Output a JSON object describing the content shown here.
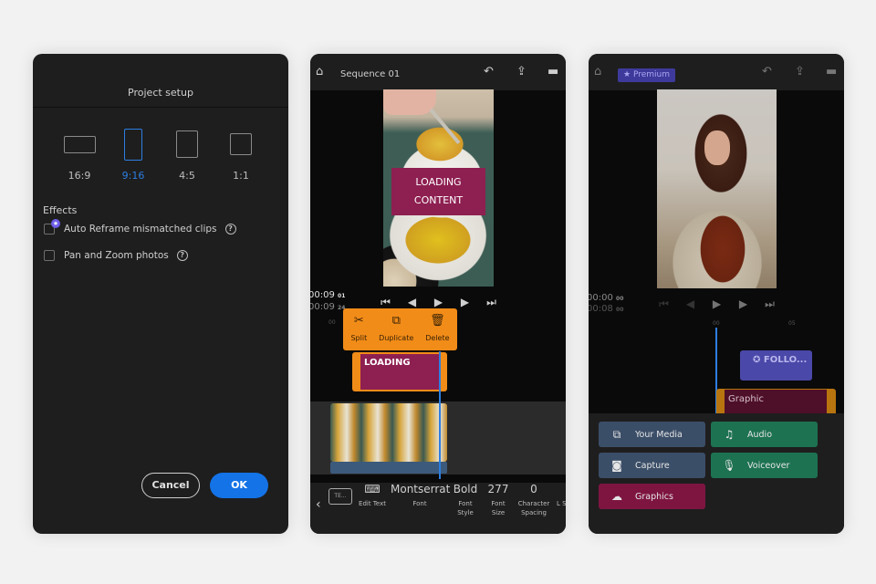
{
  "panel1": {
    "title": "Project setup",
    "aspect_ratios": [
      {
        "label": "16:9",
        "selected": false
      },
      {
        "label": "9:16",
        "selected": true
      },
      {
        "label": "4:5",
        "selected": false
      },
      {
        "label": "1:1",
        "selected": false
      }
    ],
    "effects_heading": "Effects",
    "options": [
      {
        "label": "Auto Reframe mismatched clips",
        "checked": false,
        "premium": true
      },
      {
        "label": "Pan and Zoom photos",
        "checked": false,
        "premium": false
      }
    ],
    "help_glyph": "?",
    "cancel_label": "Cancel",
    "ok_label": "OK",
    "accent": "#1473e6"
  },
  "panel2": {
    "title": "Sequence 01",
    "preview_overlay": [
      "LOADING",
      "CONTENT"
    ],
    "timecode_current": "00:09",
    "timecode_current_frames": "01",
    "timecode_total": "00:09",
    "timecode_total_frames": "24",
    "ruler_label": "00",
    "context_menu": [
      {
        "label": "Split",
        "icon": "scissors-icon"
      },
      {
        "label": "Duplicate",
        "icon": "duplicate-icon"
      },
      {
        "label": "Delete",
        "icon": "trash-icon"
      }
    ],
    "title_clip_label": "LOADING",
    "bottom_toolbar": {
      "preset_chip": "TE...",
      "items": [
        {
          "value": "",
          "caption": "Edit Text"
        },
        {
          "value": "Montserrat",
          "caption": "Font"
        },
        {
          "value": "Bold",
          "caption": "Font Style"
        },
        {
          "value": "277",
          "caption": "Font Size"
        },
        {
          "value": "0",
          "caption": "Character Spacing"
        },
        {
          "value": "",
          "caption": "L Sp"
        }
      ]
    },
    "clip_color": "#f28c18",
    "title_color": "#8e1f51"
  },
  "panel3": {
    "premium_label": "Premium",
    "timecode_current": "00:00",
    "timecode_current_frames": "00",
    "timecode_total": "00:08",
    "timecode_total_frames": "00",
    "ruler_labels": [
      "00",
      "05"
    ],
    "follow_clip_label": "FOLLO...",
    "graphic_clip_label": "Graphic",
    "add_buttons": [
      {
        "label": "Your Media",
        "icon": "media-icon",
        "color": "#3b4e68"
      },
      {
        "label": "Audio",
        "icon": "music-note-icon",
        "color": "#1d7252"
      },
      {
        "label": "Capture",
        "icon": "camera-icon",
        "color": "#3b4e68"
      },
      {
        "label": "Voiceover",
        "icon": "microphone-icon",
        "color": "#1d7252"
      },
      {
        "label": "Graphics",
        "icon": "graphics-icon",
        "color": "#7e1541"
      }
    ]
  }
}
